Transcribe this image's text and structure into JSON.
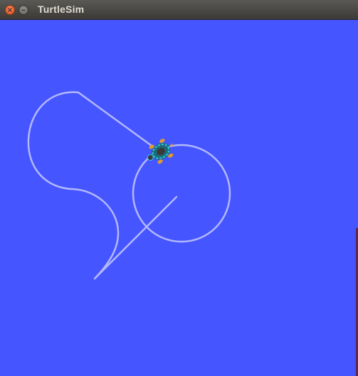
{
  "window": {
    "title": "TurtleSim",
    "close_glyph": "×",
    "minimize_glyph": "–"
  },
  "canvas": {
    "background_color": "#4555ff",
    "pen_color": "#b3b8ff",
    "turtle_icon": "turtle-icon"
  }
}
